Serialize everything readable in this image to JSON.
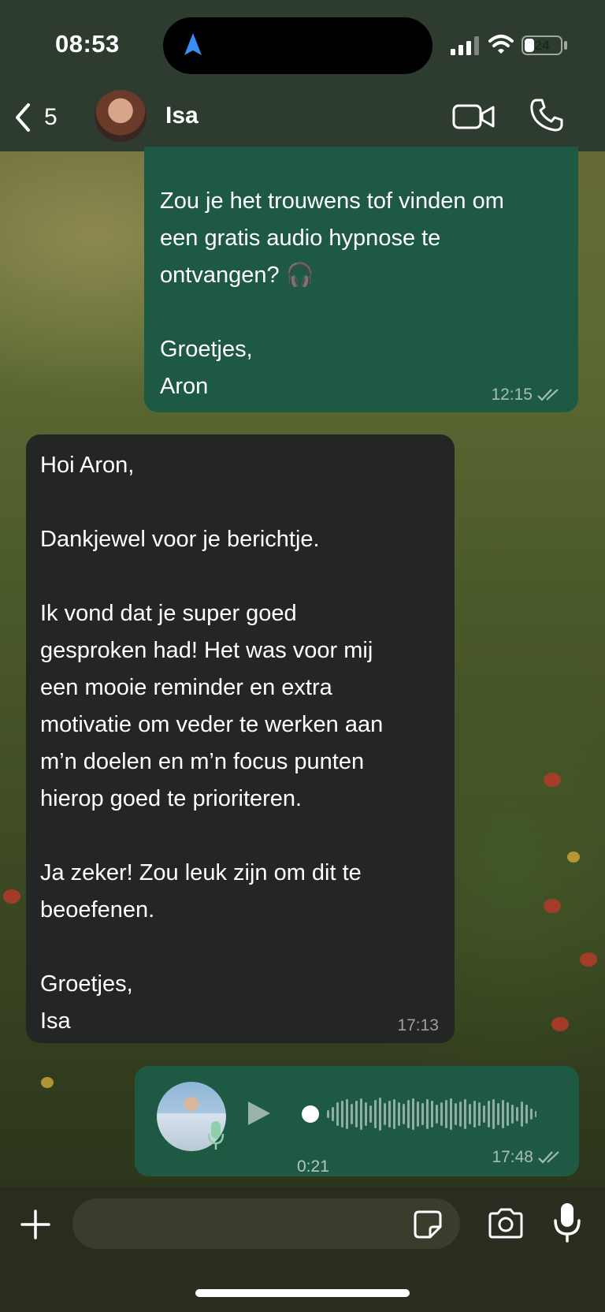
{
  "status_bar": {
    "time": "08:53",
    "battery": "24",
    "icons": [
      "location-arrow-icon",
      "cellular-signal-icon",
      "wifi-icon",
      "battery-icon"
    ]
  },
  "header": {
    "back_count": "5",
    "contact_name": "Isa",
    "icons": [
      "chevron-left-icon",
      "video-call-icon",
      "phone-icon"
    ]
  },
  "messages": [
    {
      "direction": "outgoing",
      "text": "Zou je het trouwens tof vinden om\neen gratis audio hypnose te\nontvangen? 🎧\n\nGroetjes,\nAron",
      "time": "12:15",
      "status": "read"
    },
    {
      "direction": "incoming",
      "text": "Hoi Aron,\n\nDankjewel voor je berichtje.\n\nIk vond dat je super goed\ngesproken had! Het was voor mij\neen mooie reminder en extra\nmotivatie om veder te werken aan\nm’n doelen en m’n focus punten\nhierop goed te prioriteren.\n\nJa zeker! Zou leuk zijn om dit te\nbeoefenen.\n\nGroetjes,\nIsa",
      "time": "17:13"
    },
    {
      "direction": "outgoing",
      "type": "voice",
      "duration": "0:21",
      "progress": 0,
      "time": "17:48",
      "status": "read"
    }
  ],
  "composer": {
    "placeholder": "",
    "icons": [
      "plus-icon",
      "sticker-icon",
      "camera-icon",
      "microphone-icon"
    ]
  },
  "colors": {
    "outgoing_bubble": "#1e5a43",
    "incoming_bubble": "#242626",
    "header_bg": "#2e3b2f",
    "composer_bg": "#2b2b1f"
  }
}
